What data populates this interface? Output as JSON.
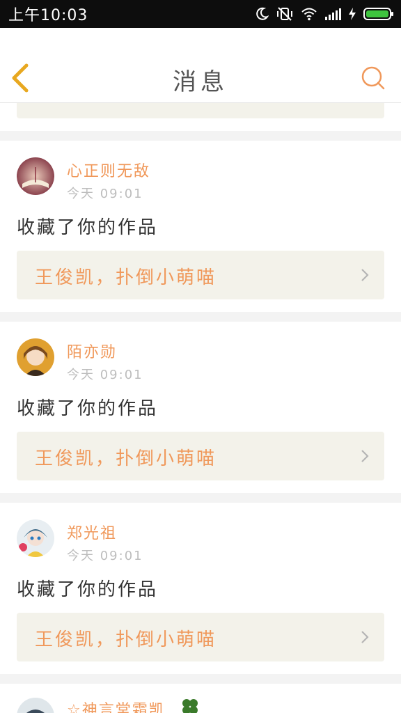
{
  "status_bar": {
    "time": "上午10:03",
    "icons": [
      "moon-icon",
      "vibrate-off-icon",
      "wifi-icon",
      "signal-icon",
      "charging-icon",
      "battery-icon"
    ]
  },
  "header": {
    "title": "消息",
    "back_icon": "chevron-left-icon",
    "search_icon": "search-icon"
  },
  "colors": {
    "accent": "#f0985a",
    "back_icon": "#e8a820",
    "card_link_bg": "#f3f2ea",
    "battery": "#3ec43e"
  },
  "messages": [
    {
      "user": "心正则无敌",
      "time": "今天 09:01",
      "action": "收藏了你的作品",
      "work_title": "王俊凯，扑倒小萌喵"
    },
    {
      "user": "陌亦勋",
      "time": "今天 09:01",
      "action": "收藏了你的作品",
      "work_title": "王俊凯，扑倒小萌喵"
    },
    {
      "user": "郑光祖",
      "time": "今天 09:01",
      "action": "收藏了你的作品",
      "work_title": "王俊凯，扑倒小萌喵"
    }
  ],
  "partial_message": {
    "user": "☆神言堂霜凯"
  }
}
